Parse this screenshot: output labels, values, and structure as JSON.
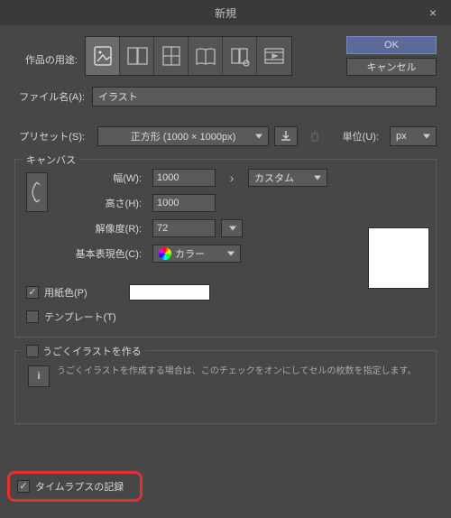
{
  "titlebar": {
    "title": "新規"
  },
  "buttons": {
    "ok": "OK",
    "cancel": "キャンセル"
  },
  "purpose": {
    "label": "作品の用途:"
  },
  "filename": {
    "label": "ファイル名(A):",
    "value": "イラスト"
  },
  "preset": {
    "label": "プリセット(S):",
    "value": "正方形 (1000 × 1000px)"
  },
  "unit": {
    "label": "単位(U):",
    "value": "px"
  },
  "canvas": {
    "legend": "キャンバス",
    "width_label": "幅(W):",
    "width_value": "1000",
    "height_label": "高さ(H):",
    "height_value": "1000",
    "resolution_label": "解像度(R):",
    "resolution_value": "72",
    "colormode_label": "基本表現色(C):",
    "colormode_value": "カラー",
    "custom": "カスタム"
  },
  "paper": {
    "label": "用紙色(P)"
  },
  "template": {
    "label": "テンプレート(T)"
  },
  "animation": {
    "label": "うごくイラストを作る",
    "hint": "うごくイラストを作成する場合は、このチェックをオンにしてセルの枚数を指定します。"
  },
  "timelapse": {
    "label": "タイムラプスの記録"
  }
}
